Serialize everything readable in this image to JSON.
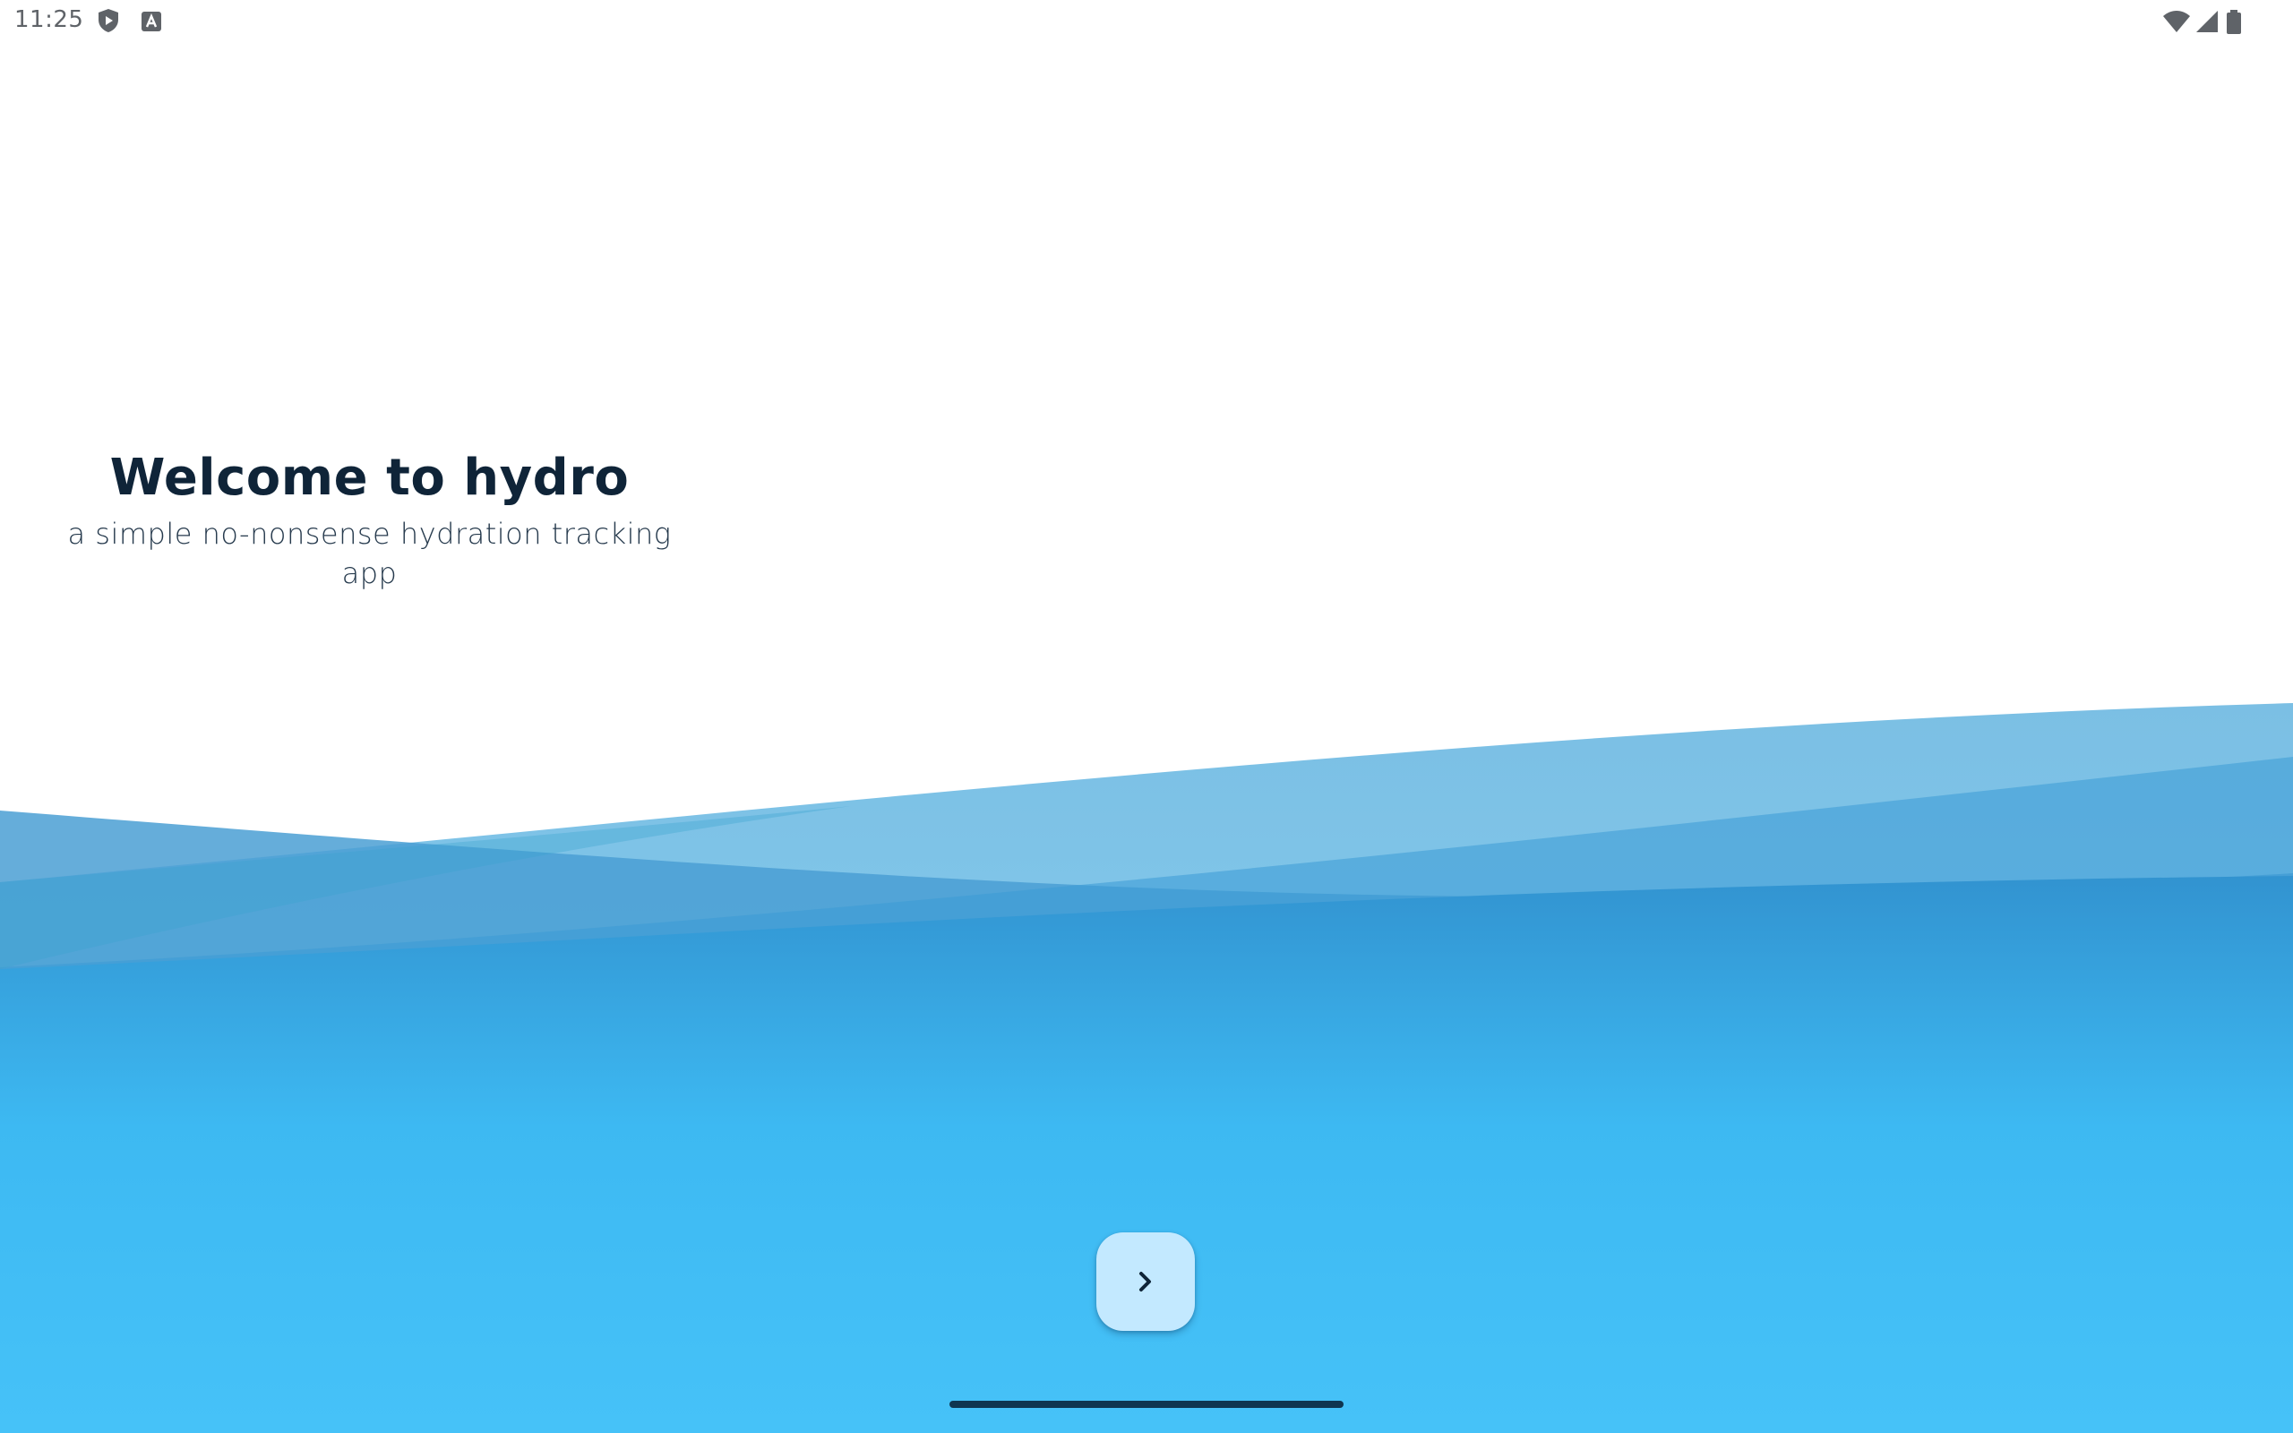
{
  "status_bar": {
    "time": "11:25",
    "left_icons": [
      "play-protect-icon",
      "app-notification-icon"
    ],
    "right_icons": [
      "wifi-icon",
      "cell-signal-icon",
      "battery-icon"
    ]
  },
  "welcome": {
    "title": "Welcome to hydro",
    "subtitle": "a simple no-nonsense hydration tracking app"
  },
  "next_button": {
    "icon": "chevron-right-icon"
  },
  "colors": {
    "background": "#ffffff",
    "title_text": "#0f2438",
    "wave_light": "#87cdee",
    "wave_mid": "#4aa3d8",
    "water_top": "#3398d4",
    "water_bottom": "#45c1f7",
    "button_bg": "#c3e9ff",
    "nav_handle": "#0f3550"
  }
}
